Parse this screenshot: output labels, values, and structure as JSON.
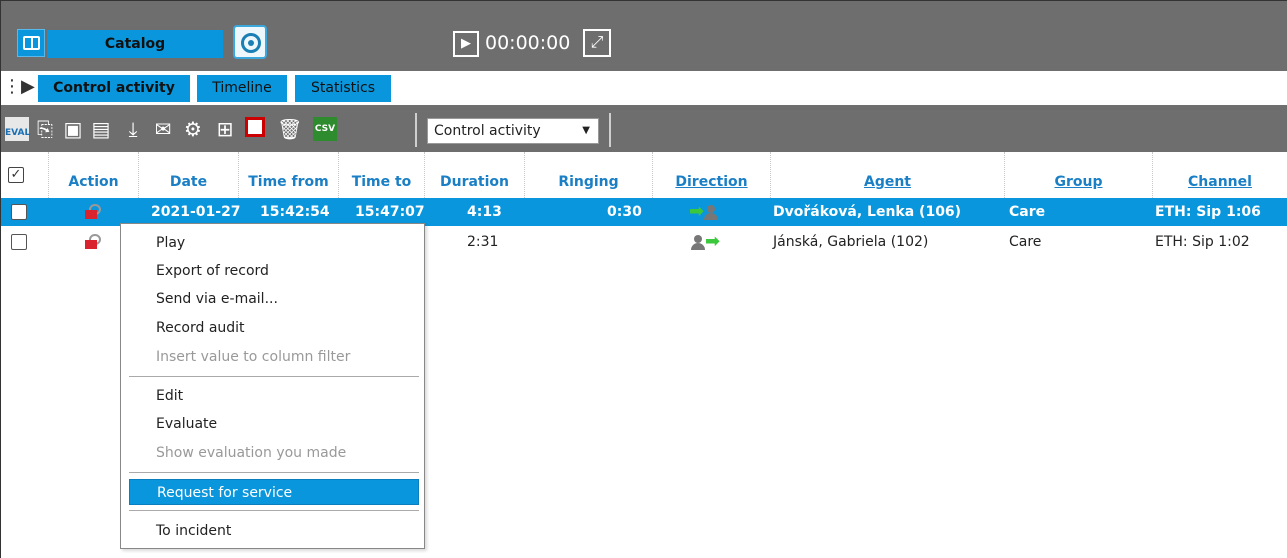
{
  "topbar": {
    "catalog_tab": "Catalog",
    "play_symbol": "▶",
    "time": "00:00:00",
    "expand_symbol": "⤢"
  },
  "tabs": [
    {
      "label": "Control activity",
      "active": true
    },
    {
      "label": "Timeline",
      "active": false
    },
    {
      "label": "Statistics",
      "active": false
    }
  ],
  "toolbar": {
    "eval_label": "EVAL",
    "csv_label": "CSV",
    "view_select": {
      "value": "Control activity",
      "arrow": "▼"
    }
  },
  "table": {
    "header_check": "✓",
    "columns": [
      "Action",
      "Date",
      "Time from",
      "Time to",
      "Duration",
      "Ringing",
      "Direction",
      "Agent",
      "Group",
      "Channel"
    ],
    "rows": [
      {
        "selected": true,
        "date": "2021-01-27",
        "time_from": "15:42:54",
        "time_to": "15:47:07",
        "duration": "4:13",
        "ringing": "0:30",
        "direction": "inbound",
        "agent": "Dvořáková, Lenka (106)",
        "group": "Care",
        "channel": "ETH: Sip 1:06"
      },
      {
        "selected": false,
        "date": "",
        "time_from": "",
        "time_to": "",
        "duration": "2:31",
        "ringing": "",
        "direction": "outbound",
        "agent": "Jánská, Gabriela (102)",
        "group": "Care",
        "channel": "ETH: Sip 1:02"
      }
    ]
  },
  "context_menu": {
    "items": [
      {
        "label": "Play",
        "disabled": false
      },
      {
        "label": "Export of record",
        "disabled": false
      },
      {
        "label": "Send via e-mail...",
        "disabled": false
      },
      {
        "label": "Record audit",
        "disabled": false
      },
      {
        "label": "Insert value to column filter",
        "disabled": true
      },
      {
        "label": "Edit",
        "disabled": false
      },
      {
        "label": "Evaluate",
        "disabled": false
      },
      {
        "label": "Show evaluation you made",
        "disabled": true
      },
      {
        "label": "Request for service",
        "disabled": false,
        "highlighted": true
      },
      {
        "label": "To incident",
        "disabled": false
      }
    ]
  },
  "colors": {
    "accent": "#0a96dc",
    "toolbar_bg": "#6e6e6e",
    "header_text": "#1a7fc5",
    "direction_arrow": "#3cc83c"
  }
}
